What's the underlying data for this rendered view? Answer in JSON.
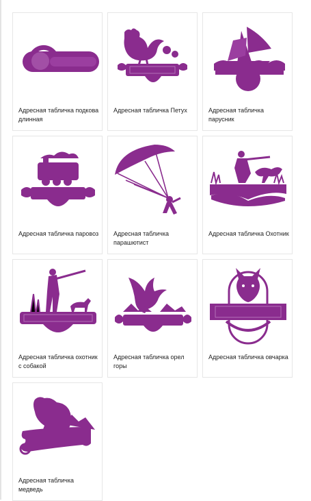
{
  "accent_color": "#8a2c8e",
  "products": [
    {
      "title": "Адресная табличка подкова длинная",
      "icon": "horseshoe-sign-icon"
    },
    {
      "title": "Адресная табличка Петух",
      "icon": "rooster-sign-icon"
    },
    {
      "title": "Адресная табличка парусник",
      "icon": "sailboat-sign-icon"
    },
    {
      "title": "Адресная табличка паровоз",
      "icon": "locomotive-sign-icon"
    },
    {
      "title": "Адресная табличка парашютист",
      "icon": "parachutist-sign-icon"
    },
    {
      "title": "Адресная табличка Охотник",
      "icon": "hunter-sign-icon"
    },
    {
      "title": "Адресная табличка охотник с собакой",
      "icon": "hunter-with-dog-sign-icon"
    },
    {
      "title": "Адресная табличка орел горы",
      "icon": "eagle-mountains-sign-icon"
    },
    {
      "title": "Адресная табличка овчарка",
      "icon": "shepherd-dog-sign-icon"
    },
    {
      "title": "Адресная табличка медведь",
      "icon": "bear-sign-icon"
    }
  ]
}
